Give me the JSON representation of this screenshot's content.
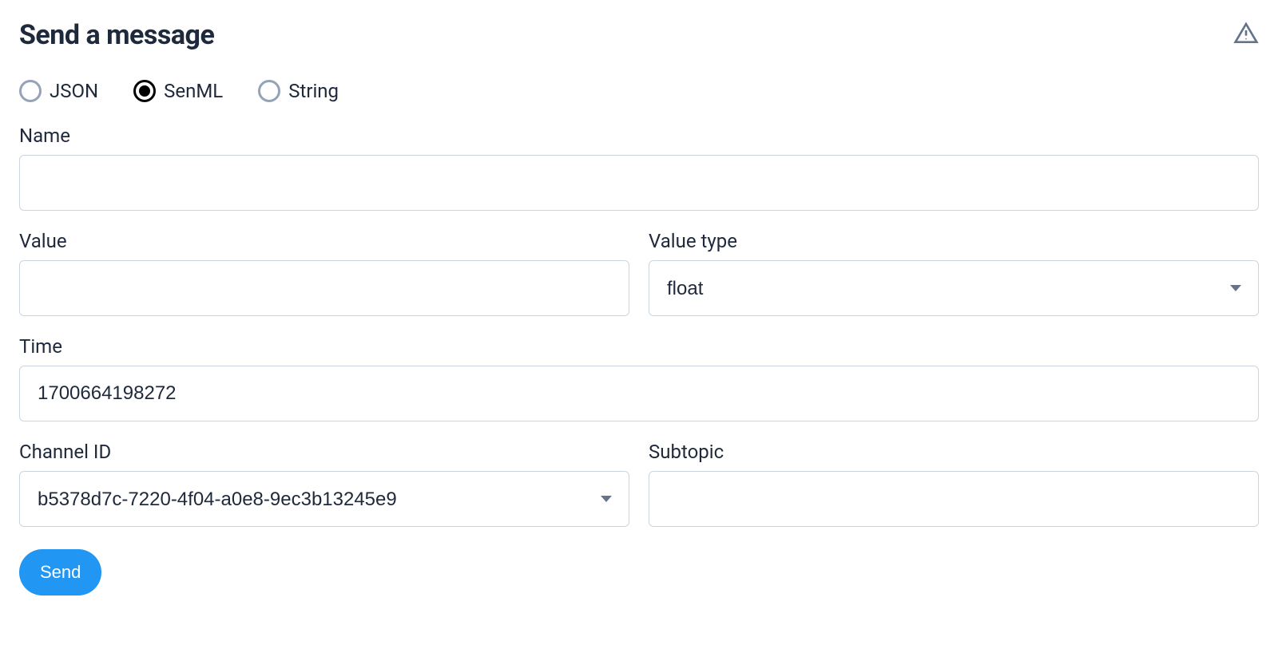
{
  "title": "Send a message",
  "format_options": {
    "json": {
      "label": "JSON",
      "selected": false
    },
    "senml": {
      "label": "SenML",
      "selected": true
    },
    "string": {
      "label": "String",
      "selected": false
    }
  },
  "fields": {
    "name": {
      "label": "Name",
      "value": ""
    },
    "value": {
      "label": "Value",
      "value": ""
    },
    "value_type": {
      "label": "Value type",
      "selected": "float"
    },
    "time": {
      "label": "Time",
      "value": "1700664198272"
    },
    "channel_id": {
      "label": "Channel ID",
      "selected": "b5378d7c-7220-4f04-a0e8-9ec3b13245e9"
    },
    "subtopic": {
      "label": "Subtopic",
      "value": ""
    }
  },
  "buttons": {
    "send": "Send"
  },
  "icons": {
    "warning": "warning-triangle"
  }
}
